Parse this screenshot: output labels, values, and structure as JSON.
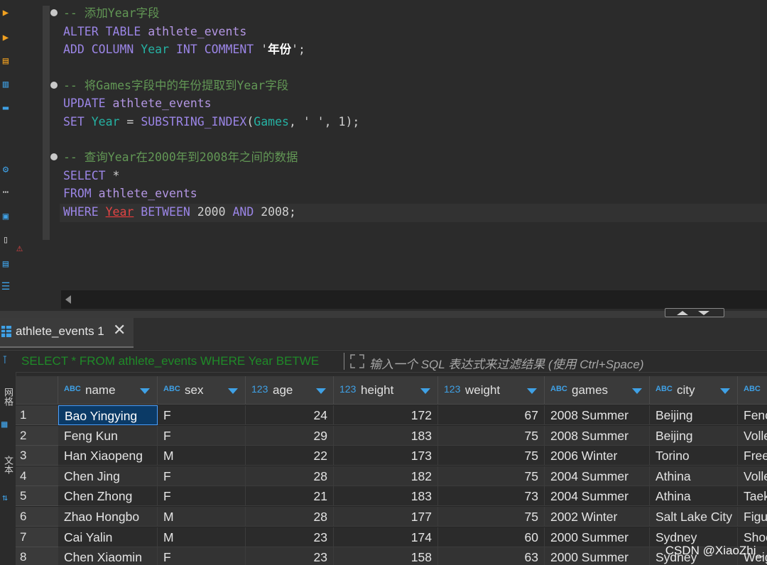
{
  "editor": {
    "blocks": [
      {
        "comment": "-- 添加Year字段",
        "lines": [
          {
            "tokens": [
              [
                "kw",
                "ALTER TABLE "
              ],
              [
                "id",
                "athlete_events"
              ]
            ]
          },
          {
            "tokens": [
              [
                "kw",
                "ADD COLUMN "
              ],
              [
                "col",
                "Year"
              ],
              [
                "kw",
                " INT "
              ],
              [
                "kw",
                "COMMENT "
              ],
              [
                "str",
                "'"
              ],
              [
                "str-bold",
                "年份"
              ],
              [
                "str",
                "';"
              ]
            ]
          }
        ]
      },
      {
        "comment": "-- 将Games字段中的年份提取到Year字段",
        "lines": [
          {
            "tokens": [
              [
                "kw",
                "UPDATE "
              ],
              [
                "id",
                "athlete_events"
              ]
            ]
          },
          {
            "tokens": [
              [
                "kw",
                "SET "
              ],
              [
                "col",
                "Year"
              ],
              [
                "op",
                " = "
              ],
              [
                "kw",
                "SUBSTRING_INDEX"
              ],
              [
                "op",
                "("
              ],
              [
                "col",
                "Games"
              ],
              [
                "op",
                ", "
              ],
              [
                "str",
                "' '"
              ],
              [
                "op",
                ", "
              ],
              [
                "num",
                "1"
              ],
              [
                "op",
                ");"
              ]
            ]
          }
        ]
      },
      {
        "comment": "-- 查询Year在2000年到2008年之间的数据",
        "lines": [
          {
            "tokens": [
              [
                "kw",
                "SELECT "
              ],
              [
                "op",
                "*"
              ]
            ]
          },
          {
            "tokens": [
              [
                "kw",
                "FROM "
              ],
              [
                "id",
                "athlete_events"
              ]
            ]
          },
          {
            "tokens": [
              [
                "kw",
                "WHERE "
              ],
              [
                "err",
                "Year"
              ],
              [
                "kw",
                " BETWEEN "
              ],
              [
                "num",
                "2000"
              ],
              [
                "kw",
                " AND "
              ],
              [
                "num",
                "2008"
              ],
              [
                "op",
                ";"
              ]
            ]
          }
        ]
      }
    ]
  },
  "results_tab": {
    "label": "athlete_events 1",
    "close_glyph": "✕"
  },
  "filter": {
    "sql_text": "SELECT * FROM athlete_events WHERE Year BETWE",
    "hint": "输入一个 SQL 表达式来过滤结果 (使用 Ctrl+Space)"
  },
  "side_strip": {
    "tab_grid": "网格",
    "tab_text": "文本"
  },
  "grid": {
    "columns": [
      {
        "type": "ABC",
        "name": "name",
        "numeric": false
      },
      {
        "type": "ABC",
        "name": "sex",
        "numeric": false
      },
      {
        "type": "123",
        "name": "age",
        "numeric": true
      },
      {
        "type": "123",
        "name": "height",
        "numeric": true
      },
      {
        "type": "123",
        "name": "weight",
        "numeric": true
      },
      {
        "type": "ABC",
        "name": "games",
        "numeric": false
      },
      {
        "type": "ABC",
        "name": "city",
        "numeric": false
      },
      {
        "type": "ABC",
        "name": "",
        "numeric": false
      }
    ],
    "rows": [
      {
        "n": "1",
        "cells": [
          "Bao Yingying",
          "F",
          "24",
          "172",
          "67",
          "2008 Summer",
          "Beijing",
          "Fenc"
        ]
      },
      {
        "n": "2",
        "cells": [
          "Feng Kun",
          "F",
          "29",
          "183",
          "75",
          "2008 Summer",
          "Beijing",
          "Volle"
        ]
      },
      {
        "n": "3",
        "cells": [
          "Han Xiaopeng",
          "M",
          "22",
          "173",
          "75",
          "2006 Winter",
          "Torino",
          "Free"
        ]
      },
      {
        "n": "4",
        "cells": [
          "Chen Jing",
          "F",
          "28",
          "182",
          "75",
          "2004 Summer",
          "Athina",
          "Volle"
        ]
      },
      {
        "n": "5",
        "cells": [
          "Chen Zhong",
          "F",
          "21",
          "183",
          "73",
          "2004 Summer",
          "Athina",
          "Taek"
        ]
      },
      {
        "n": "6",
        "cells": [
          "Zhao Hongbo",
          "M",
          "28",
          "177",
          "75",
          "2002 Winter",
          "Salt Lake City",
          "Figu"
        ]
      },
      {
        "n": "7",
        "cells": [
          "Cai Yalin",
          "M",
          "23",
          "174",
          "60",
          "2000 Summer",
          "Sydney",
          "Shoo"
        ]
      },
      {
        "n": "8",
        "cells": [
          "Chen Xiaomin",
          "F",
          "23",
          "158",
          "63",
          "2000 Summer",
          "Sydney",
          "Weig"
        ]
      }
    ]
  },
  "watermark": "CSDN @XiaoZhi_",
  "colors": {
    "accent": "#3fa1e6",
    "comment": "#629755",
    "keyword": "#9b85e6",
    "error": "#ff3b3b"
  }
}
